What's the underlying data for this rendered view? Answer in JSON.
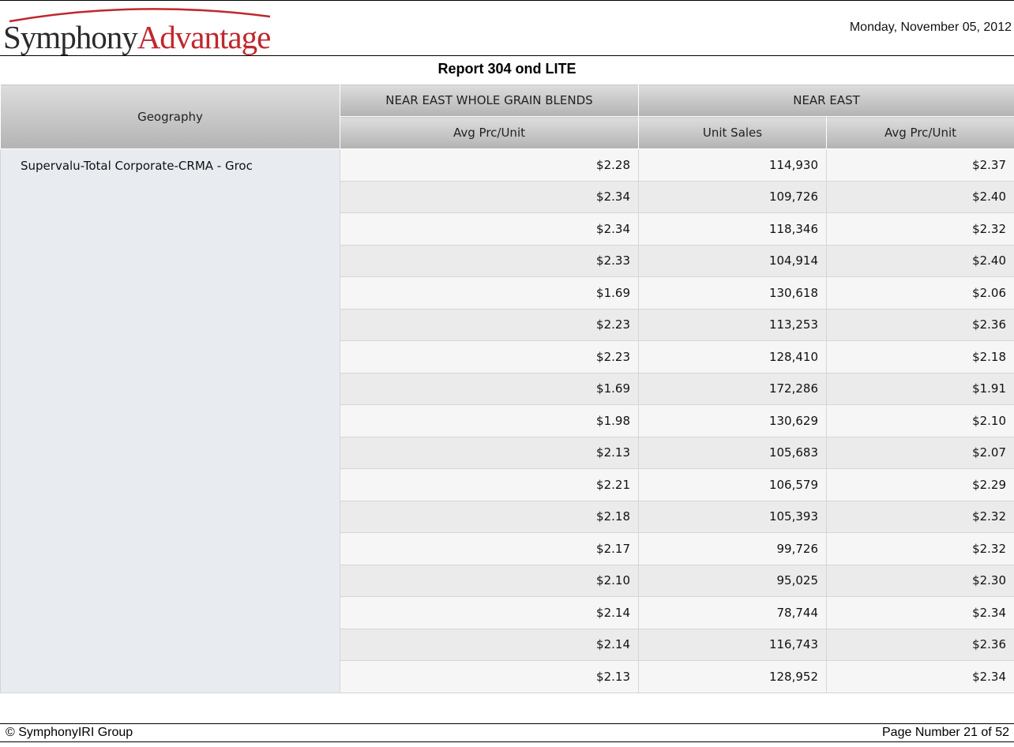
{
  "header": {
    "logo_part1": "Symphony",
    "logo_part2": "Advantage",
    "date": "Monday, November 05, 2012"
  },
  "report": {
    "title": "Report 304 ond LITE"
  },
  "table": {
    "geography_header": "Geography",
    "group1_header": "NEAR EAST WHOLE GRAIN BLENDS",
    "group2_header": "NEAR EAST",
    "sub_col1": "Avg Prc/Unit",
    "sub_col2": "Unit Sales",
    "sub_col3": "Avg Prc/Unit",
    "geography": "Supervalu-Total Corporate-CRMA - Groc",
    "rows": [
      [
        "$2.28",
        "114,930",
        "$2.37"
      ],
      [
        "$2.34",
        "109,726",
        "$2.40"
      ],
      [
        "$2.34",
        "118,346",
        "$2.32"
      ],
      [
        "$2.33",
        "104,914",
        "$2.40"
      ],
      [
        "$1.69",
        "130,618",
        "$2.06"
      ],
      [
        "$2.23",
        "113,253",
        "$2.36"
      ],
      [
        "$2.23",
        "128,410",
        "$2.18"
      ],
      [
        "$1.69",
        "172,286",
        "$1.91"
      ],
      [
        "$1.98",
        "130,629",
        "$2.10"
      ],
      [
        "$2.13",
        "105,683",
        "$2.07"
      ],
      [
        "$2.21",
        "106,579",
        "$2.29"
      ],
      [
        "$2.18",
        "105,393",
        "$2.32"
      ],
      [
        "$2.17",
        "99,726",
        "$2.32"
      ],
      [
        "$2.10",
        "95,025",
        "$2.30"
      ],
      [
        "$2.14",
        "78,744",
        "$2.34"
      ],
      [
        "$2.14",
        "116,743",
        "$2.36"
      ],
      [
        "$2.13",
        "128,952",
        "$2.34"
      ]
    ]
  },
  "footer": {
    "copyright": "© SymphonyIRI Group",
    "page_number": "Page Number 21 of 52"
  },
  "colors": {
    "logo_red": "#c0272d",
    "logo_dark": "#2b2b2b",
    "header_gray": "#c4c4c4"
  }
}
